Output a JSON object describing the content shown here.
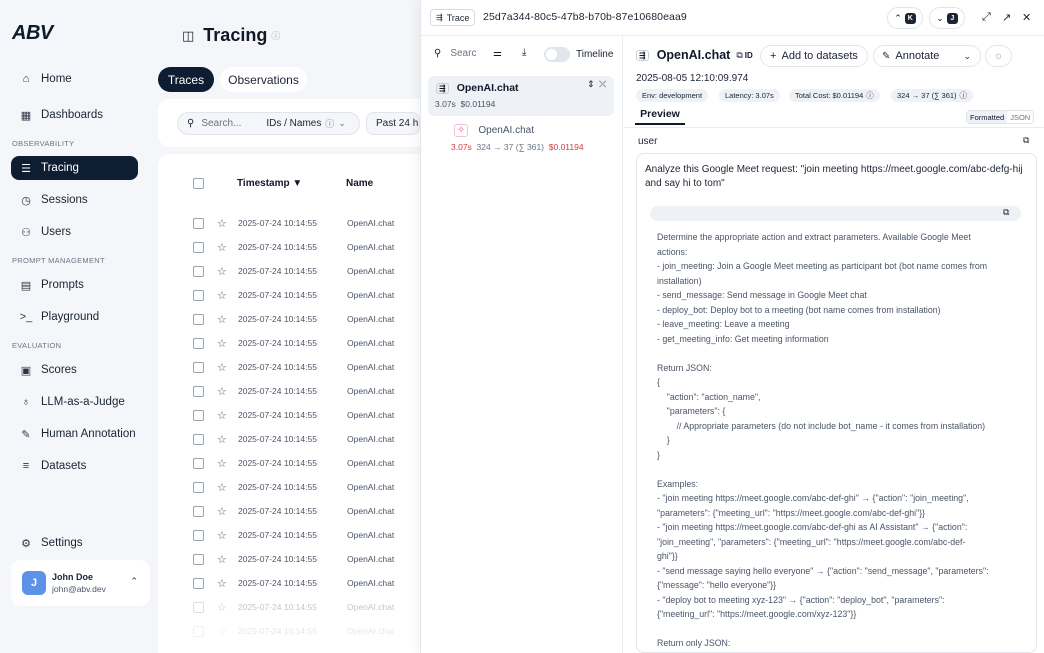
{
  "app": {
    "logo": "ABV"
  },
  "sidebar": {
    "items": [
      {
        "label": "Home",
        "icon": "home-icon"
      },
      {
        "label": "Dashboards",
        "icon": "dashboard-icon"
      },
      {
        "label": "Tracing",
        "icon": "tracing-icon"
      },
      {
        "label": "Sessions",
        "icon": "clock-icon"
      },
      {
        "label": "Users",
        "icon": "users-icon"
      },
      {
        "label": "Prompts",
        "icon": "file-icon"
      },
      {
        "label": "Playground",
        "icon": "terminal-icon"
      },
      {
        "label": "Scores",
        "icon": "scores-icon"
      },
      {
        "label": "LLM-as-a-Judge",
        "icon": "lightbulb-icon"
      },
      {
        "label": "Human Annotation",
        "icon": "annotation-icon"
      },
      {
        "label": "Datasets",
        "icon": "database-icon"
      }
    ],
    "sections": {
      "observability": "OBSERVABILITY",
      "prompt_management": "PROMPT MANAGEMENT",
      "evaluation": "EVALUATION"
    },
    "settings": "Settings",
    "user": {
      "initial": "J",
      "name": "John Doe",
      "email": "john@abv.dev"
    }
  },
  "main": {
    "title": "Tracing",
    "tabs": [
      "Traces",
      "Observations"
    ],
    "search_placeholder": "Search...",
    "search_mode": "IDs / Names",
    "time_filter": "Past 24 h",
    "columns": {
      "timestamp": "Timestamp ▼",
      "name": "Name"
    },
    "rows": [
      {
        "timestamp": "2025-07-24 10:14:55",
        "name": "OpenAI.chat"
      },
      {
        "timestamp": "2025-07-24 10:14:55",
        "name": "OpenAI.chat"
      },
      {
        "timestamp": "2025-07-24 10:14:55",
        "name": "OpenAI.chat"
      },
      {
        "timestamp": "2025-07-24 10:14:55",
        "name": "OpenAI.chat"
      },
      {
        "timestamp": "2025-07-24 10:14:55",
        "name": "OpenAI.chat"
      },
      {
        "timestamp": "2025-07-24 10:14:55",
        "name": "OpenAI.chat"
      },
      {
        "timestamp": "2025-07-24 10:14:55",
        "name": "OpenAI.chat"
      },
      {
        "timestamp": "2025-07-24 10:14:55",
        "name": "OpenAI.chat"
      },
      {
        "timestamp": "2025-07-24 10:14:55",
        "name": "OpenAI.chat"
      },
      {
        "timestamp": "2025-07-24 10:14:55",
        "name": "OpenAI.chat"
      },
      {
        "timestamp": "2025-07-24 10:14:55",
        "name": "OpenAI.chat"
      },
      {
        "timestamp": "2025-07-24 10:14:55",
        "name": "OpenAI.chat"
      },
      {
        "timestamp": "2025-07-24 10:14:55",
        "name": "OpenAI.chat"
      },
      {
        "timestamp": "2025-07-24 10:14:55",
        "name": "OpenAI.chat"
      },
      {
        "timestamp": "2025-07-24 10:14:55",
        "name": "OpenAI.chat"
      },
      {
        "timestamp": "2025-07-24 10:14:55",
        "name": "OpenAI.chat"
      },
      {
        "timestamp": "2025-07-24 10:14:55",
        "name": "OpenAI.chat"
      },
      {
        "timestamp": "2025-07-24 10:14:55",
        "name": "OpenAI.chat"
      }
    ]
  },
  "trace": {
    "badge": "Trace",
    "id": "25d7a344-80c5-47b8-b70b-87e10680eaa9",
    "prev_key": "K",
    "next_key": "J",
    "search_placeholder": "Search",
    "timeline_label": "Timeline",
    "tree": {
      "root": {
        "name": "OpenAI.chat",
        "latency": "3.07s",
        "cost": "$0.01194"
      },
      "child": {
        "name": "OpenAI.chat",
        "latency": "3.07s",
        "tokens": "324 → 37 (∑ 361)",
        "cost": "$0.01194"
      }
    },
    "detail": {
      "title": "OpenAI.chat",
      "id_label": "ID",
      "add_to_datasets": "Add to datasets",
      "annotate": "Annotate",
      "date": "2025-08-05 12:10:09.974",
      "chips": [
        "Env: development",
        "Latency: 3.07s",
        "Total Cost: $0.01194",
        "324 → 37 (∑ 361)"
      ],
      "preview_tab": "Preview",
      "formatted": "Formatted",
      "json": "JSON",
      "role": "user",
      "message": "Analyze this Google Meet request: \"join meeting https://meet.google.com/abc-defg-hij  and say hi to tom\"",
      "system_text": "Determine the appropriate action and extract parameters. Available Google Meet\nactions:\n- join_meeting: Join a Google Meet meeting as participant bot (bot name comes from\ninstallation)\n- send_message: Send message in Google Meet chat\n- deploy_bot: Deploy bot to a meeting (bot name comes from installation)\n- leave_meeting: Leave a meeting\n- get_meeting_info: Get meeting information\n\nReturn JSON:\n{\n    \"action\": \"action_name\",\n    \"parameters\": {\n        // Appropriate parameters (do not include bot_name - it comes from installation)\n    }\n}\n\nExamples:\n- \"join meeting https://meet.google.com/abc-def-ghi\" → {\"action\": \"join_meeting\",\n\"parameters\": {\"meeting_url\": \"https://meet.google.com/abc-def-ghi\"}}\n- \"join meeting https://meet.google.com/abc-def-ghi as AI Assistant\" → {\"action\":\n\"join_meeting\", \"parameters\": {\"meeting_url\": \"https://meet.google.com/abc-def-\nghi\"}}\n- \"send message saying hello everyone\" → {\"action\": \"send_message\", \"parameters\":\n{\"message\": \"hello everyone\"}}\n- \"deploy bot to meeting xyz-123\" → {\"action\": \"deploy_bot\", \"parameters\":\n{\"meeting_url\": \"https://meet.google.com/xyz-123\"}}\n\nReturn only JSON:"
    }
  },
  "colors": {
    "accent_dark": "#0f1d33",
    "cost_red": "#d43b3b"
  }
}
